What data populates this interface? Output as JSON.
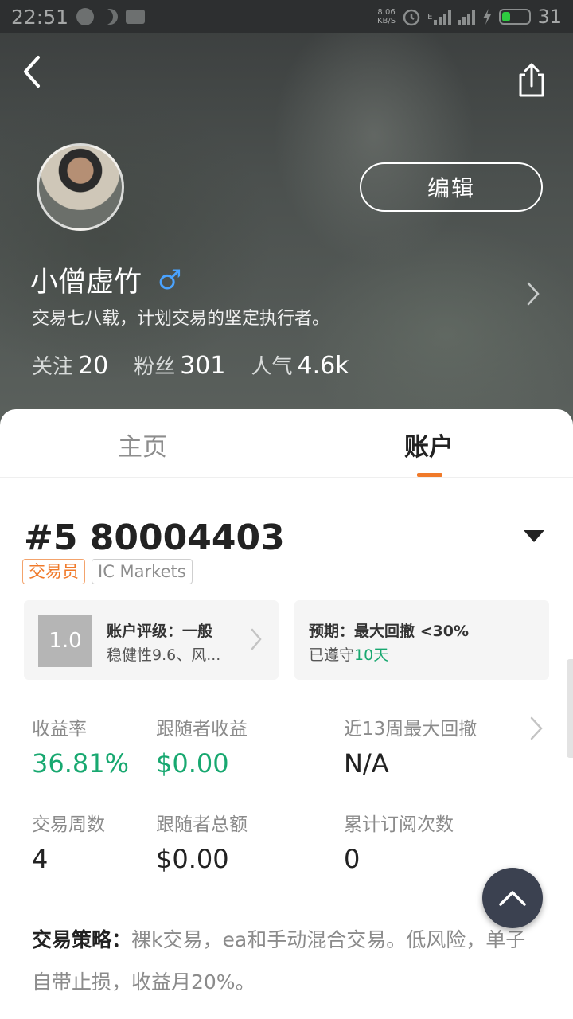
{
  "status_bar": {
    "time": "22:51",
    "net_speed_value": "8.06",
    "net_speed_unit": "KB/S",
    "battery_level": "31",
    "signal_label": "E"
  },
  "header": {
    "back_icon": "back-arrow-icon",
    "share_icon": "share-icon",
    "edit_label": "编辑"
  },
  "profile": {
    "name": "小僧虚竹",
    "gender_symbol": "♂",
    "bio": "交易七八载，计划交易的坚定执行者。",
    "stats": [
      {
        "label": "关注",
        "value": "20"
      },
      {
        "label": "粉丝",
        "value": "301"
      },
      {
        "label": "人气",
        "value": "4.6k"
      }
    ]
  },
  "tabs": {
    "home": "主页",
    "account": "账户",
    "active": "account"
  },
  "account": {
    "number": "#5 80004403",
    "tags": [
      "交易员",
      "IC Markets"
    ],
    "rating": {
      "score": "1.0",
      "title": "账户评级：一般",
      "subtitle": "稳健性9.6、风..."
    },
    "expectation": {
      "title": "预期：最大回撤 <30%",
      "sub_prefix": "已遵守",
      "sub_value": "10天"
    },
    "metrics": [
      {
        "label": "收益率",
        "value": "36.81%"
      },
      {
        "label": "跟随者收益",
        "value": "$0.00"
      },
      {
        "label": "近13周最大回撤",
        "value": "N/A"
      },
      {
        "label": "交易周数",
        "value": "4"
      },
      {
        "label": "跟随者总额",
        "value": "$0.00"
      },
      {
        "label": "累计订阅次数",
        "value": "0"
      }
    ],
    "strategy_label": "交易策略：",
    "strategy_text": "裸k交易，ea和手动混合交易。低风险，单子自带止损，收益月20%。"
  },
  "colors": {
    "accent_orange": "#f07a2a",
    "positive_green": "#18a870",
    "gender_blue": "#4aa3ff"
  }
}
